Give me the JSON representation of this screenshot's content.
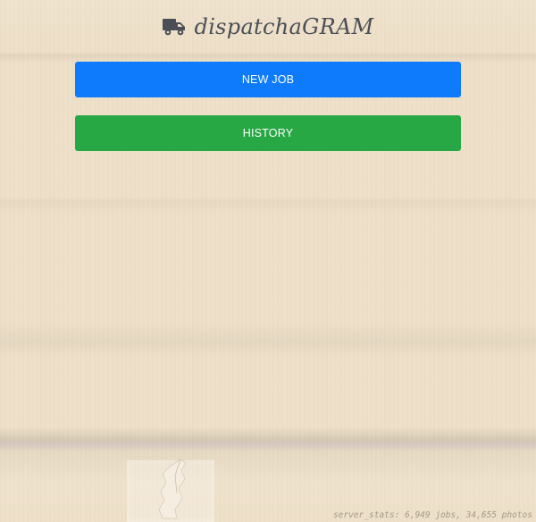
{
  "header": {
    "brand": "dispatchaGRAM",
    "icon": "truck-icon"
  },
  "actions": {
    "new_job_label": "NEW JOB",
    "history_label": "HISTORY"
  },
  "footer": {
    "stats": "server_stats: 6,949 jobs, 34,655 photos"
  },
  "colors": {
    "new_job": "#0d7bfb",
    "history": "#28a745",
    "brand_text": "#4a4f57",
    "background": "#eee0c8"
  }
}
